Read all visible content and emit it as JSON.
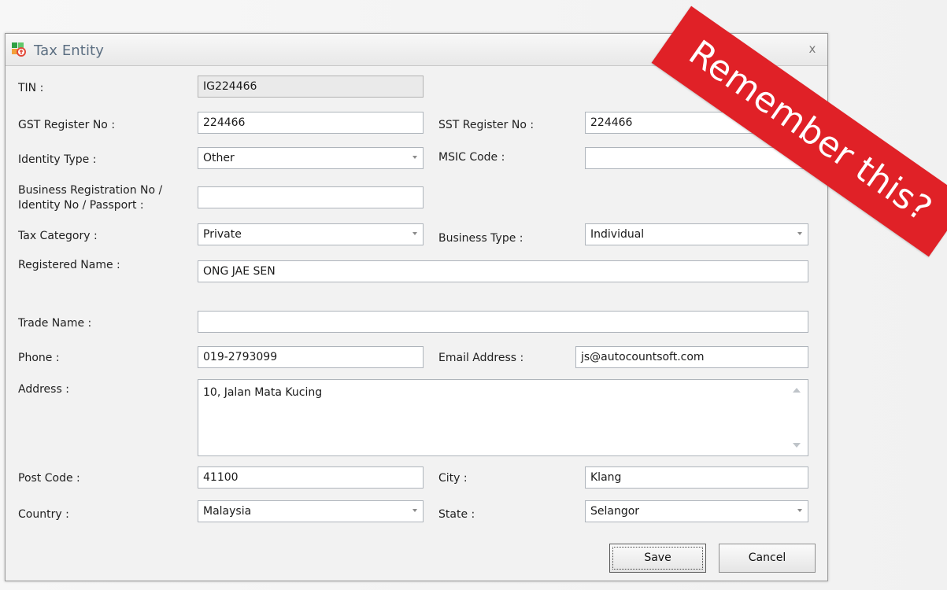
{
  "window": {
    "title": "Tax Entity",
    "close_glyph": "x",
    "icon": "tax-entity-app-icon"
  },
  "form": {
    "tin": {
      "label": "TIN :",
      "value": "IG224466"
    },
    "gst": {
      "label": "GST Register No :",
      "value": "224466"
    },
    "sst": {
      "label": "SST Register No :",
      "value": "224466"
    },
    "identity_type": {
      "label": "Identity Type :",
      "value": "Other"
    },
    "msic": {
      "label": "MSIC Code :",
      "value": ""
    },
    "business_reg": {
      "label_line1": "Business Registration No /",
      "label_line2": "Identity No / Passport :",
      "value": ""
    },
    "tax_category": {
      "label": "Tax Category :",
      "value": "Private"
    },
    "business_type": {
      "label": "Business Type :",
      "value": "Individual"
    },
    "registered_name": {
      "label": "Registered Name :",
      "value": "ONG JAE SEN"
    },
    "trade_name": {
      "label": "Trade Name :",
      "value": ""
    },
    "phone": {
      "label": "Phone :",
      "value": "019-2793099"
    },
    "email": {
      "label": "Email Address :",
      "value": "js@autocountsoft.com"
    },
    "address": {
      "label": "Address :",
      "value": "10, Jalan Mata Kucing"
    },
    "post_code": {
      "label": "Post Code :",
      "value": "41100"
    },
    "city": {
      "label": "City :",
      "value": "Klang"
    },
    "country": {
      "label": "Country :",
      "value": "Malaysia"
    },
    "state": {
      "label": "State :",
      "value": "Selangor"
    }
  },
  "buttons": {
    "save": "Save",
    "cancel": "Cancel"
  },
  "banner": {
    "text": "Remember this?",
    "color": "#e02127"
  },
  "colors": {
    "title_text": "#5c6f82",
    "dialog_bg": "#f2f2f2",
    "field_border": "#aeb4bb"
  }
}
